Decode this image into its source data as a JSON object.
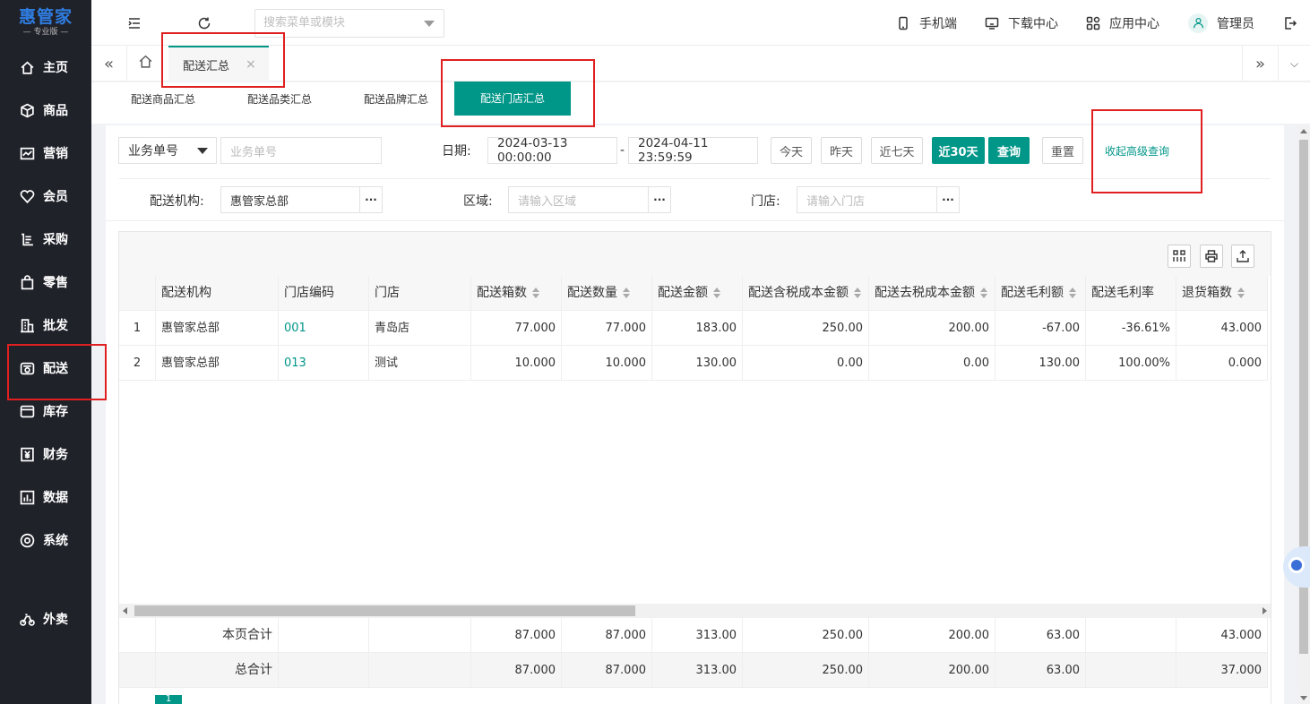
{
  "brand": {
    "name": "惠管家",
    "edition": "— 专业版 —",
    "color": "#2f7de1"
  },
  "accent": "#009688",
  "sidebar": {
    "items": [
      {
        "label": "主页",
        "icon": "home-icon"
      },
      {
        "label": "商品",
        "icon": "box-icon"
      },
      {
        "label": "营销",
        "icon": "chart-icon"
      },
      {
        "label": "会员",
        "icon": "heart-icon"
      },
      {
        "label": "采购",
        "icon": "cart-icon"
      },
      {
        "label": "零售",
        "icon": "bag-icon"
      },
      {
        "label": "批发",
        "icon": "building-icon"
      },
      {
        "label": "配送",
        "icon": "truck-icon"
      },
      {
        "label": "库存",
        "icon": "storage-icon"
      },
      {
        "label": "财务",
        "icon": "yuan-icon"
      },
      {
        "label": "数据",
        "icon": "bar-chart-icon"
      },
      {
        "label": "系统",
        "icon": "settings-icon"
      },
      {
        "label": "外卖",
        "icon": "bike-icon"
      }
    ]
  },
  "topbar": {
    "search_placeholder": "搜索菜单或模块",
    "mobile": "手机端",
    "download": "下载中心",
    "apps": "应用中心",
    "user": "管理员"
  },
  "tabs": {
    "active": "配送汇总",
    "close": "×"
  },
  "subtabs": [
    "配送商品汇总",
    "配送品类汇总",
    "配送品牌汇总",
    "配送门店汇总"
  ],
  "filters": {
    "type_select": "业务单号",
    "order_placeholder": "业务单号",
    "date_label": "日期:",
    "date_from": "2024-03-13 00:00:00",
    "date_sep": "-",
    "date_to": "2024-04-11 23:59:59",
    "btn_today": "今天",
    "btn_yesterday": "昨天",
    "btn_7days": "近七天",
    "btn_30days": "近30天",
    "btn_query": "查询",
    "btn_reset": "重置",
    "link_collapse": "收起高级查询",
    "org_label": "配送机构:",
    "org_value": "惠管家总部",
    "region_label": "区域:",
    "region_placeholder": "请输入区域",
    "store_label": "门店:",
    "store_placeholder": "请输入门店",
    "dots": "···"
  },
  "table": {
    "headers": [
      "配送机构",
      "门店编码",
      "门店",
      "配送箱数",
      "配送数量",
      "配送金额",
      "配送含税成本金额",
      "配送去税成本金额",
      "配送毛利额",
      "配送毛利率",
      "退货箱数"
    ],
    "rows": [
      {
        "idx": "1",
        "org": "惠管家总部",
        "code": "001",
        "store": "青岛店",
        "boxes": "77.000",
        "qty": "77.000",
        "amount": "183.00",
        "cost_tax": "250.00",
        "cost_notax": "200.00",
        "profit": "-67.00",
        "rate": "-36.61%",
        "ret_boxes": "43.000"
      },
      {
        "idx": "2",
        "org": "惠管家总部",
        "code": "013",
        "store": "测试",
        "boxes": "10.000",
        "qty": "10.000",
        "amount": "130.00",
        "cost_tax": "0.00",
        "cost_notax": "0.00",
        "profit": "130.00",
        "rate": "100.00%",
        "ret_boxes": "0.000"
      }
    ],
    "page_total": {
      "label": "本页合计",
      "boxes": "87.000",
      "qty": "87.000",
      "amount": "313.00",
      "cost_tax": "250.00",
      "cost_notax": "200.00",
      "profit": "63.00",
      "ret_boxes": "43.000"
    },
    "grand_total": {
      "label": "总合计",
      "boxes": "87.000",
      "qty": "87.000",
      "amount": "313.00",
      "cost_tax": "250.00",
      "cost_notax": "200.00",
      "profit": "63.00",
      "ret_boxes": "37.000"
    }
  },
  "pager": {
    "current": "1"
  }
}
